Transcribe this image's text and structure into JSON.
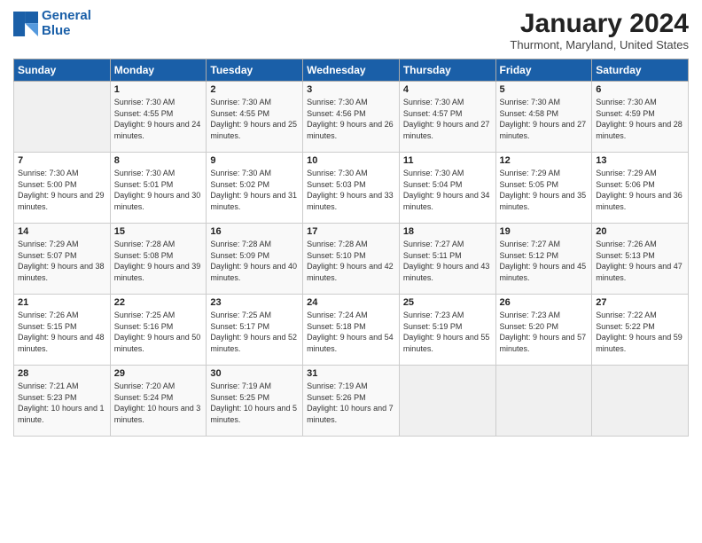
{
  "header": {
    "logo_line1": "General",
    "logo_line2": "Blue",
    "month_year": "January 2024",
    "location": "Thurmont, Maryland, United States"
  },
  "days_of_week": [
    "Sunday",
    "Monday",
    "Tuesday",
    "Wednesday",
    "Thursday",
    "Friday",
    "Saturday"
  ],
  "weeks": [
    [
      {
        "num": "",
        "sunrise": "",
        "sunset": "",
        "daylight": ""
      },
      {
        "num": "1",
        "sunrise": "7:30 AM",
        "sunset": "4:55 PM",
        "daylight": "9 hours and 24 minutes."
      },
      {
        "num": "2",
        "sunrise": "7:30 AM",
        "sunset": "4:55 PM",
        "daylight": "9 hours and 25 minutes."
      },
      {
        "num": "3",
        "sunrise": "7:30 AM",
        "sunset": "4:56 PM",
        "daylight": "9 hours and 26 minutes."
      },
      {
        "num": "4",
        "sunrise": "7:30 AM",
        "sunset": "4:57 PM",
        "daylight": "9 hours and 27 minutes."
      },
      {
        "num": "5",
        "sunrise": "7:30 AM",
        "sunset": "4:58 PM",
        "daylight": "9 hours and 27 minutes."
      },
      {
        "num": "6",
        "sunrise": "7:30 AM",
        "sunset": "4:59 PM",
        "daylight": "9 hours and 28 minutes."
      }
    ],
    [
      {
        "num": "7",
        "sunrise": "7:30 AM",
        "sunset": "5:00 PM",
        "daylight": "9 hours and 29 minutes."
      },
      {
        "num": "8",
        "sunrise": "7:30 AM",
        "sunset": "5:01 PM",
        "daylight": "9 hours and 30 minutes."
      },
      {
        "num": "9",
        "sunrise": "7:30 AM",
        "sunset": "5:02 PM",
        "daylight": "9 hours and 31 minutes."
      },
      {
        "num": "10",
        "sunrise": "7:30 AM",
        "sunset": "5:03 PM",
        "daylight": "9 hours and 33 minutes."
      },
      {
        "num": "11",
        "sunrise": "7:30 AM",
        "sunset": "5:04 PM",
        "daylight": "9 hours and 34 minutes."
      },
      {
        "num": "12",
        "sunrise": "7:29 AM",
        "sunset": "5:05 PM",
        "daylight": "9 hours and 35 minutes."
      },
      {
        "num": "13",
        "sunrise": "7:29 AM",
        "sunset": "5:06 PM",
        "daylight": "9 hours and 36 minutes."
      }
    ],
    [
      {
        "num": "14",
        "sunrise": "7:29 AM",
        "sunset": "5:07 PM",
        "daylight": "9 hours and 38 minutes."
      },
      {
        "num": "15",
        "sunrise": "7:28 AM",
        "sunset": "5:08 PM",
        "daylight": "9 hours and 39 minutes."
      },
      {
        "num": "16",
        "sunrise": "7:28 AM",
        "sunset": "5:09 PM",
        "daylight": "9 hours and 40 minutes."
      },
      {
        "num": "17",
        "sunrise": "7:28 AM",
        "sunset": "5:10 PM",
        "daylight": "9 hours and 42 minutes."
      },
      {
        "num": "18",
        "sunrise": "7:27 AM",
        "sunset": "5:11 PM",
        "daylight": "9 hours and 43 minutes."
      },
      {
        "num": "19",
        "sunrise": "7:27 AM",
        "sunset": "5:12 PM",
        "daylight": "9 hours and 45 minutes."
      },
      {
        "num": "20",
        "sunrise": "7:26 AM",
        "sunset": "5:13 PM",
        "daylight": "9 hours and 47 minutes."
      }
    ],
    [
      {
        "num": "21",
        "sunrise": "7:26 AM",
        "sunset": "5:15 PM",
        "daylight": "9 hours and 48 minutes."
      },
      {
        "num": "22",
        "sunrise": "7:25 AM",
        "sunset": "5:16 PM",
        "daylight": "9 hours and 50 minutes."
      },
      {
        "num": "23",
        "sunrise": "7:25 AM",
        "sunset": "5:17 PM",
        "daylight": "9 hours and 52 minutes."
      },
      {
        "num": "24",
        "sunrise": "7:24 AM",
        "sunset": "5:18 PM",
        "daylight": "9 hours and 54 minutes."
      },
      {
        "num": "25",
        "sunrise": "7:23 AM",
        "sunset": "5:19 PM",
        "daylight": "9 hours and 55 minutes."
      },
      {
        "num": "26",
        "sunrise": "7:23 AM",
        "sunset": "5:20 PM",
        "daylight": "9 hours and 57 minutes."
      },
      {
        "num": "27",
        "sunrise": "7:22 AM",
        "sunset": "5:22 PM",
        "daylight": "9 hours and 59 minutes."
      }
    ],
    [
      {
        "num": "28",
        "sunrise": "7:21 AM",
        "sunset": "5:23 PM",
        "daylight": "10 hours and 1 minute."
      },
      {
        "num": "29",
        "sunrise": "7:20 AM",
        "sunset": "5:24 PM",
        "daylight": "10 hours and 3 minutes."
      },
      {
        "num": "30",
        "sunrise": "7:19 AM",
        "sunset": "5:25 PM",
        "daylight": "10 hours and 5 minutes."
      },
      {
        "num": "31",
        "sunrise": "7:19 AM",
        "sunset": "5:26 PM",
        "daylight": "10 hours and 7 minutes."
      },
      {
        "num": "",
        "sunrise": "",
        "sunset": "",
        "daylight": ""
      },
      {
        "num": "",
        "sunrise": "",
        "sunset": "",
        "daylight": ""
      },
      {
        "num": "",
        "sunrise": "",
        "sunset": "",
        "daylight": ""
      }
    ]
  ]
}
